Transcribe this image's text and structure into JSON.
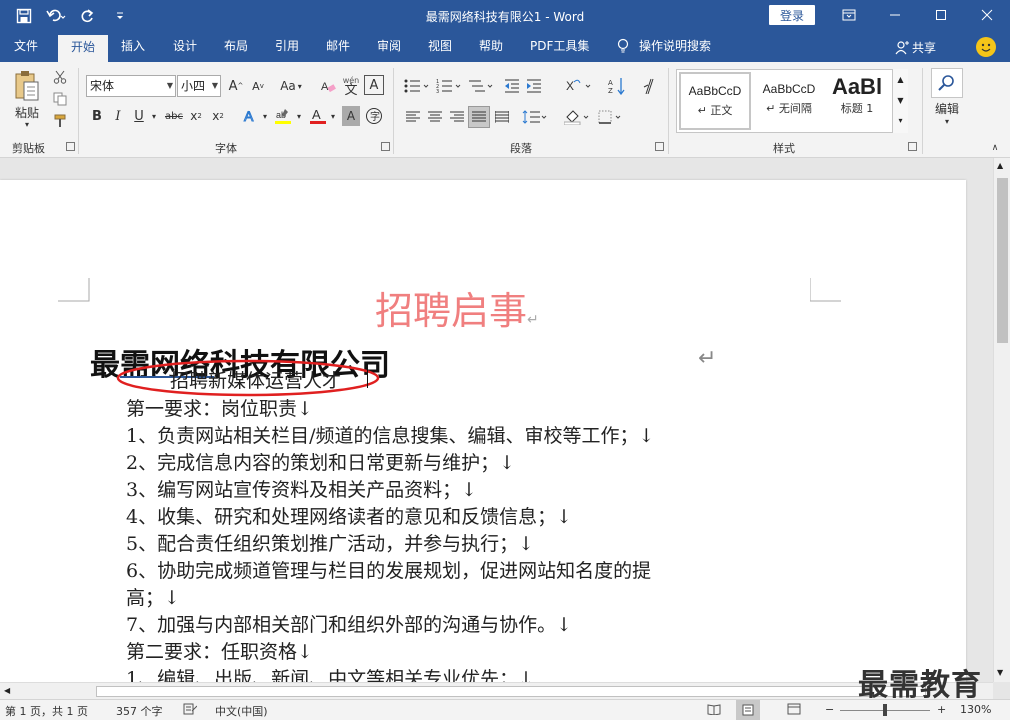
{
  "window": {
    "title": "最需网络科技有限公1  -  Word",
    "login_label": "登录"
  },
  "tabs": [
    {
      "label": "文件"
    },
    {
      "label": "开始"
    },
    {
      "label": "插入"
    },
    {
      "label": "设计"
    },
    {
      "label": "布局"
    },
    {
      "label": "引用"
    },
    {
      "label": "邮件"
    },
    {
      "label": "审阅"
    },
    {
      "label": "视图"
    },
    {
      "label": "帮助"
    },
    {
      "label": "PDF工具集"
    },
    {
      "label": "操作说明搜索"
    }
  ],
  "share_label": "共享",
  "ribbon": {
    "clipboard": {
      "label": "剪贴板",
      "paste_label": "粘贴"
    },
    "font": {
      "label": "字体",
      "font_name": "宋体",
      "font_size": "小四",
      "change_case": "Aa",
      "phonetic_top": "wén",
      "phonetic_char": "文"
    },
    "paragraph": {
      "label": "段落"
    },
    "styles": {
      "label": "样式",
      "items": [
        {
          "sample": "AaBbCcD",
          "name": "↵ 正文"
        },
        {
          "sample": "AaBbCcD",
          "name": "↵ 无间隔"
        },
        {
          "sample": "AaBl",
          "name": "标题 1"
        }
      ]
    },
    "editing": {
      "label": "编辑"
    }
  },
  "document": {
    "heading": "招聘启事",
    "company": "最需网络科技有限公司",
    "position": "招聘新媒体运营人才",
    "lines": [
      "第一要求：岗位职责↓",
      "1、负责网站相关栏目/频道的信息搜集、编辑、审校等工作；↓",
      "2、完成信息内容的策划和日常更新与维护；↓",
      "3、编写网站宣传资料及相关产品资料；↓",
      "4、收集、研究和处理网络读者的意见和反馈信息；↓",
      "5、配合责任组织策划推广活动，并参与执行；↓",
      "6、协助完成频道管理与栏目的发展规划，促进网站知名度的提",
      "高；↓",
      "7、加强与内部相关部门和组织外部的沟通与协作。↓",
      "第二要求：任职资格↓",
      "1、编辑、出版、新闻、中文等相关专业优先；↓"
    ]
  },
  "status": {
    "page": "第 1 页，共 1 页",
    "words": "357 个字",
    "language": "中文(中国)",
    "zoom": "130%"
  },
  "watermark": "最需教育",
  "colors": {
    "brand": "#2b579a",
    "heading": "#f07f7f",
    "annotation": "#e02020"
  }
}
